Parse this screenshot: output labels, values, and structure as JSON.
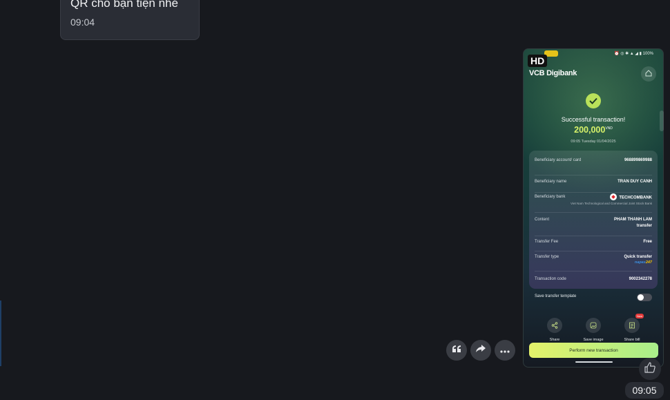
{
  "received_message": {
    "text": "QR cho bạn tiện nhé",
    "time": "09:04"
  },
  "message_actions": {
    "items": [
      {
        "name": "quote-icon"
      },
      {
        "name": "forward-icon"
      },
      {
        "name": "more-icon"
      }
    ]
  },
  "image_message": {
    "hd_label": "HD",
    "status_bar": "⏰ ◎ ✱ ▲ ◢ ▮ 100%",
    "app_name": "VCB Digibank",
    "success_title": "Successful transaction!",
    "amount": "200,000",
    "currency": "VND",
    "datetime": "09:05 Tuesday 01/04/2025",
    "details": [
      {
        "label": "Beneficiary account/ card",
        "value": "968899869988"
      },
      {
        "label": "Beneficiary name",
        "value": "TRAN DUY CANH"
      },
      {
        "label": "Beneficiary bank",
        "value": "TECHCOMBANK",
        "sub": "Viet Nam Technological and Commercial Joint Stock Bank"
      },
      {
        "label": "Content",
        "value": "PHAM THANH LAM transfer"
      },
      {
        "label": "Transfer Fee",
        "value": "Free"
      },
      {
        "label": "Transfer type",
        "value": "Quick transfer",
        "badge_a": "napas",
        "badge_b": "247"
      },
      {
        "label": "Transaction code",
        "value": "9002342278"
      }
    ],
    "save_template_label": "Save transfer template",
    "save_template_on": false,
    "share_actions": [
      {
        "label": "Share"
      },
      {
        "label": "Save image"
      },
      {
        "label": "Share bill",
        "badge": "New"
      }
    ],
    "primary_button": "Perform new transaction"
  },
  "sent_time": "09:05",
  "colors": {
    "background": "#17191e",
    "bubble": "#2a2d35",
    "accent_lime": "#d7f26a"
  }
}
